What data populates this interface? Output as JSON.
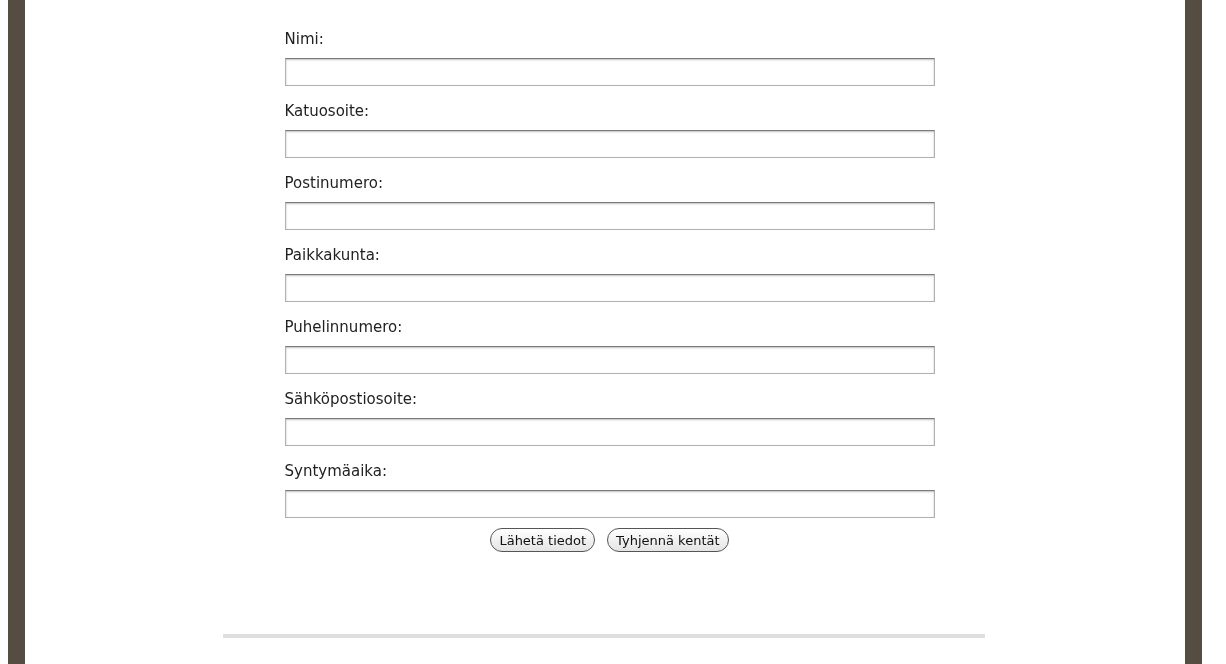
{
  "form": {
    "fields": [
      {
        "label": "Nimi:"
      },
      {
        "label": "Katuosoite:"
      },
      {
        "label": "Postinumero:"
      },
      {
        "label": "Paikkakunta:"
      },
      {
        "label": "Puhelinnumero:"
      },
      {
        "label": "Sähköpostiosoite:"
      },
      {
        "label": "Syntymäaika:"
      }
    ],
    "buttons": [
      "Lähetä tiedot",
      "Tyhjennä kentät"
    ]
  }
}
